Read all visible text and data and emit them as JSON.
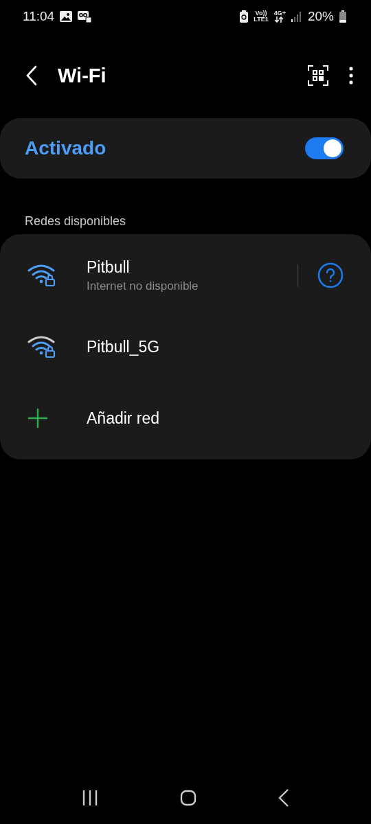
{
  "status_bar": {
    "time": "11:04",
    "volte": "Vo))",
    "lte": "LTE1",
    "network": "4G+",
    "battery": "20%"
  },
  "header": {
    "title": "Wi-Fi"
  },
  "master_switch": {
    "label": "Activado",
    "on": true
  },
  "section_title": "Redes disponibles",
  "networks": [
    {
      "kind": "network",
      "name": "Pitbull",
      "status": "Internet no disponible",
      "full_signal": true,
      "help": true
    },
    {
      "kind": "network",
      "name": "Pitbull_5G",
      "full_signal": false,
      "help": false
    },
    {
      "kind": "add",
      "name": "Añadir red"
    }
  ]
}
